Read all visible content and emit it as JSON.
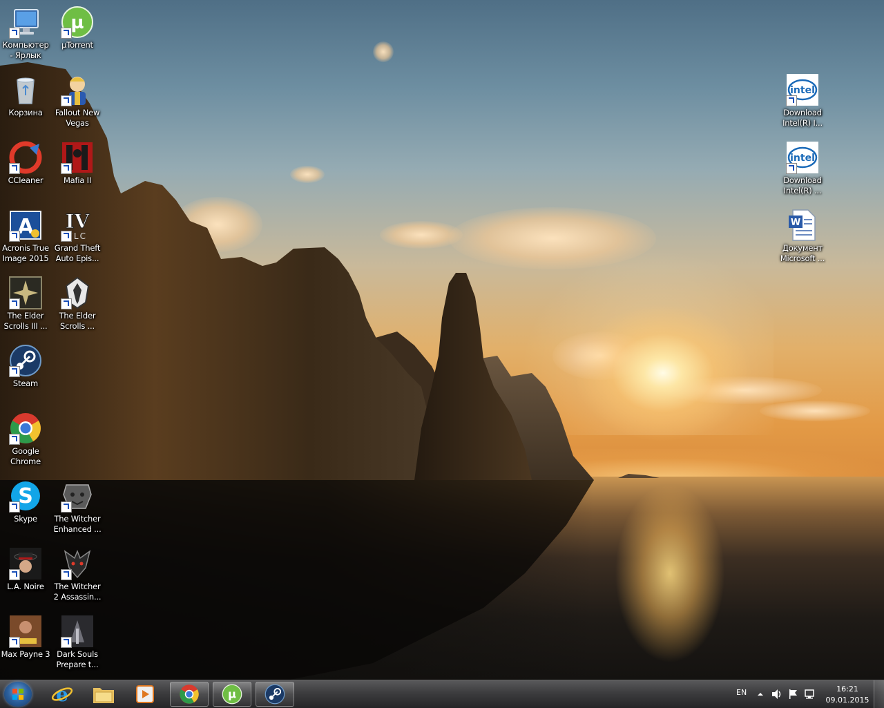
{
  "desktop": {
    "left_column": [
      {
        "name": "computer-shortcut",
        "label": "Компьютер\n- Ярлык",
        "icon": "computer-icon"
      },
      {
        "name": "recycle-bin",
        "label": "Корзина",
        "icon": "recycle-bin-icon"
      },
      {
        "name": "ccleaner-shortcut",
        "label": "CCleaner",
        "icon": "ccleaner-icon"
      },
      {
        "name": "acronis-shortcut",
        "label": "Acronis True\nImage 2015",
        "icon": "acronis-icon"
      },
      {
        "name": "elder-scrolls-3-shortcut",
        "label": "The Elder\nScrolls III ...",
        "icon": "morrowind-icon"
      },
      {
        "name": "steam-shortcut",
        "label": "Steam",
        "icon": "steam-icon"
      },
      {
        "name": "chrome-shortcut",
        "label": "Google\nChrome",
        "icon": "chrome-icon"
      },
      {
        "name": "skype-shortcut",
        "label": "Skype",
        "icon": "skype-icon"
      },
      {
        "name": "la-noire-shortcut",
        "label": "L.A. Noire",
        "icon": "la-noire-icon"
      },
      {
        "name": "max-payne-3-shortcut",
        "label": "Max Payne 3",
        "icon": "max-payne-icon"
      }
    ],
    "second_column": [
      {
        "name": "utorrent-shortcut",
        "label": "µTorrent",
        "icon": "utorrent-icon"
      },
      {
        "name": "fallout-nv-shortcut",
        "label": "Fallout New\nVegas",
        "icon": "fallout-icon"
      },
      {
        "name": "mafia-2-shortcut",
        "label": "Mafia II",
        "icon": "mafia-icon"
      },
      {
        "name": "gta-4-shortcut",
        "label": "Grand Theft\nAuto Epis...",
        "icon": "gta-iv-icon"
      },
      {
        "name": "elder-scrolls-5-shortcut",
        "label": "The Elder\nScrolls ...",
        "icon": "skyrim-icon"
      },
      {
        "name": "witcher-1-shortcut",
        "label": "The Witcher\nEnhanced ...",
        "icon": "witcher-icon"
      },
      {
        "name": "witcher-2-shortcut",
        "label": "The Witcher\n2 Assassin...",
        "icon": "witcher2-icon"
      },
      {
        "name": "dark-souls-shortcut",
        "label": "Dark Souls\nPrepare t...",
        "icon": "dark-souls-icon"
      }
    ],
    "right_column": [
      {
        "name": "intel-download-1",
        "label": "Download\nIntel(R) I...",
        "icon": "intel-icon"
      },
      {
        "name": "intel-download-2",
        "label": "Download\nIntel(R) ...",
        "icon": "intel-icon"
      },
      {
        "name": "word-document",
        "label": "Документ\nMicrosoft ...",
        "icon": "word-document-icon"
      }
    ]
  },
  "taskbar": {
    "start_icon": "windows-start-icon",
    "pinned": [
      {
        "name": "internet-explorer",
        "icon": "internet-explorer-icon",
        "active": false
      },
      {
        "name": "windows-explorer",
        "icon": "folder-icon",
        "active": false
      },
      {
        "name": "media-player",
        "icon": "media-player-icon",
        "active": false
      },
      {
        "name": "google-chrome",
        "icon": "chrome-icon",
        "active": true
      },
      {
        "name": "utorrent",
        "icon": "utorrent-icon",
        "active": true
      },
      {
        "name": "steam",
        "icon": "steam-icon",
        "active": true
      }
    ],
    "tray": {
      "language": "EN",
      "time": "16:21",
      "date": "09.01.2015",
      "icons": [
        "show-hidden-icons-icon",
        "volume-icon",
        "action-center-flag-icon",
        "network-icon"
      ]
    }
  }
}
